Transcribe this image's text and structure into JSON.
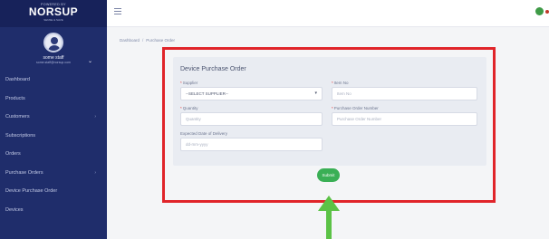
{
  "brand": {
    "tagline": "POWERED BY",
    "name": "NORSUP",
    "subtitle": "SENSE & SAVE"
  },
  "user": {
    "name": "some staff",
    "email": "some.staff@norsup.com"
  },
  "sidebar": {
    "items": [
      {
        "label": "Dashboard",
        "has_chevron": false
      },
      {
        "label": "Products",
        "has_chevron": false
      },
      {
        "label": "Customers",
        "has_chevron": true
      },
      {
        "label": "Subscriptions",
        "has_chevron": false
      },
      {
        "label": "Orders",
        "has_chevron": false
      },
      {
        "label": "Purchase Orders",
        "has_chevron": true
      },
      {
        "label": "Device Purchase Order",
        "has_chevron": false
      },
      {
        "label": "Devices",
        "has_chevron": false
      }
    ]
  },
  "breadcrumb": {
    "home": "Dashboard",
    "separator": "/",
    "current": "Purchase Order"
  },
  "form": {
    "title": "Device Purchase Order",
    "supplier": {
      "label": "Supplier",
      "value": "--SELECT SUPPLIER--"
    },
    "item_no": {
      "label": "Item No",
      "placeholder": "Item No"
    },
    "quantity": {
      "label": "Quantity",
      "placeholder": "Quantity"
    },
    "po_number": {
      "label": "Purchase Order Number",
      "placeholder": "Purchase Order Number"
    },
    "delivery_date": {
      "label": "Expected Date of Delivery",
      "placeholder": "dd-mm-yyyy"
    },
    "submit_label": "Submit"
  },
  "colors": {
    "sidebar": "#1f2d6b",
    "highlight": "#e0242a",
    "submit": "#3aaf55",
    "arrow": "#5bc246"
  }
}
